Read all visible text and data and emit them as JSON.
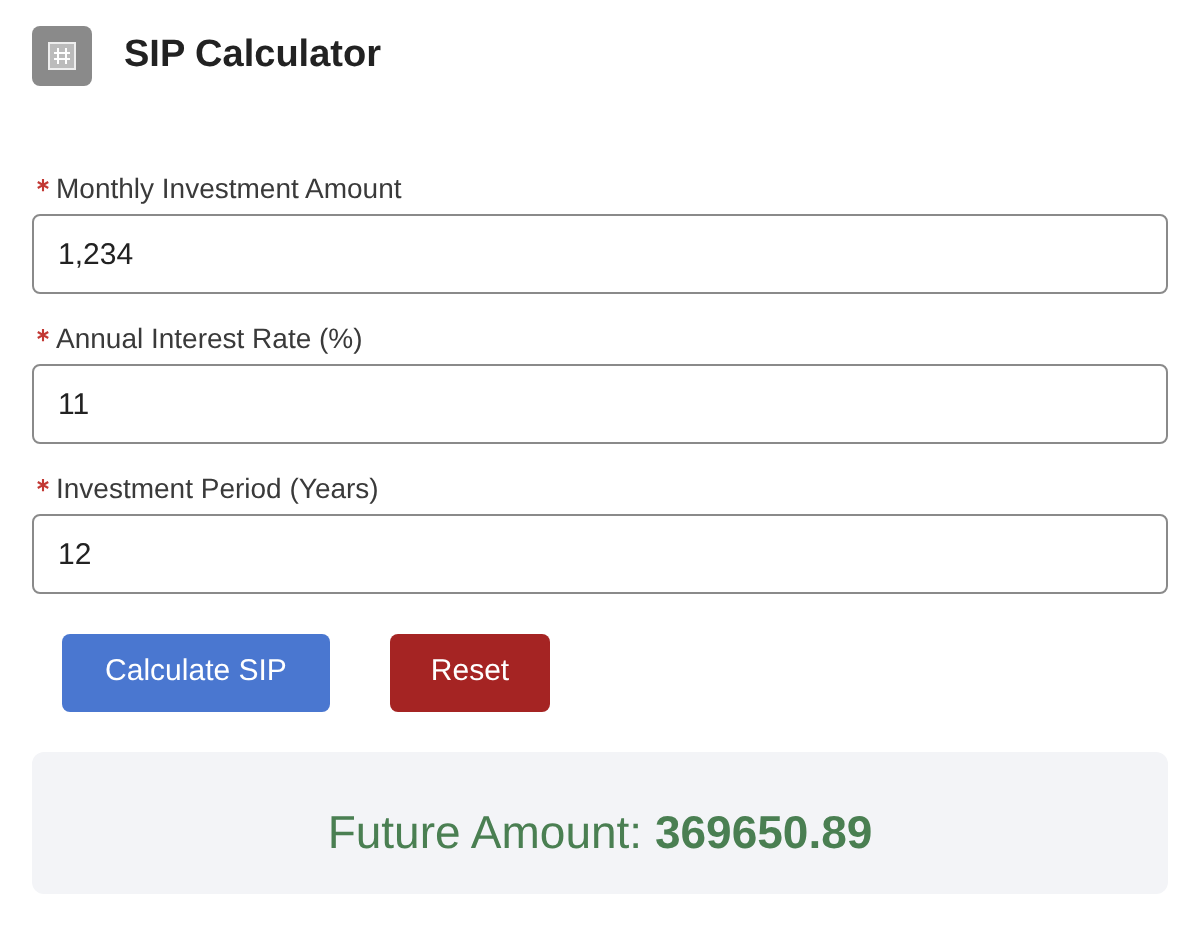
{
  "header": {
    "title": "SIP Calculator"
  },
  "fields": [
    {
      "label": "Monthly Investment Amount",
      "required": true,
      "value": "1,234"
    },
    {
      "label": "Annual Interest Rate (%)",
      "required": true,
      "value": "11"
    },
    {
      "label": "Investment Period (Years)",
      "required": true,
      "value": "12"
    }
  ],
  "buttons": [
    {
      "label": "Calculate SIP",
      "kind": "primary"
    },
    {
      "label": "Reset",
      "kind": "danger"
    }
  ],
  "result": "Future Amount: **369650.89**"
}
